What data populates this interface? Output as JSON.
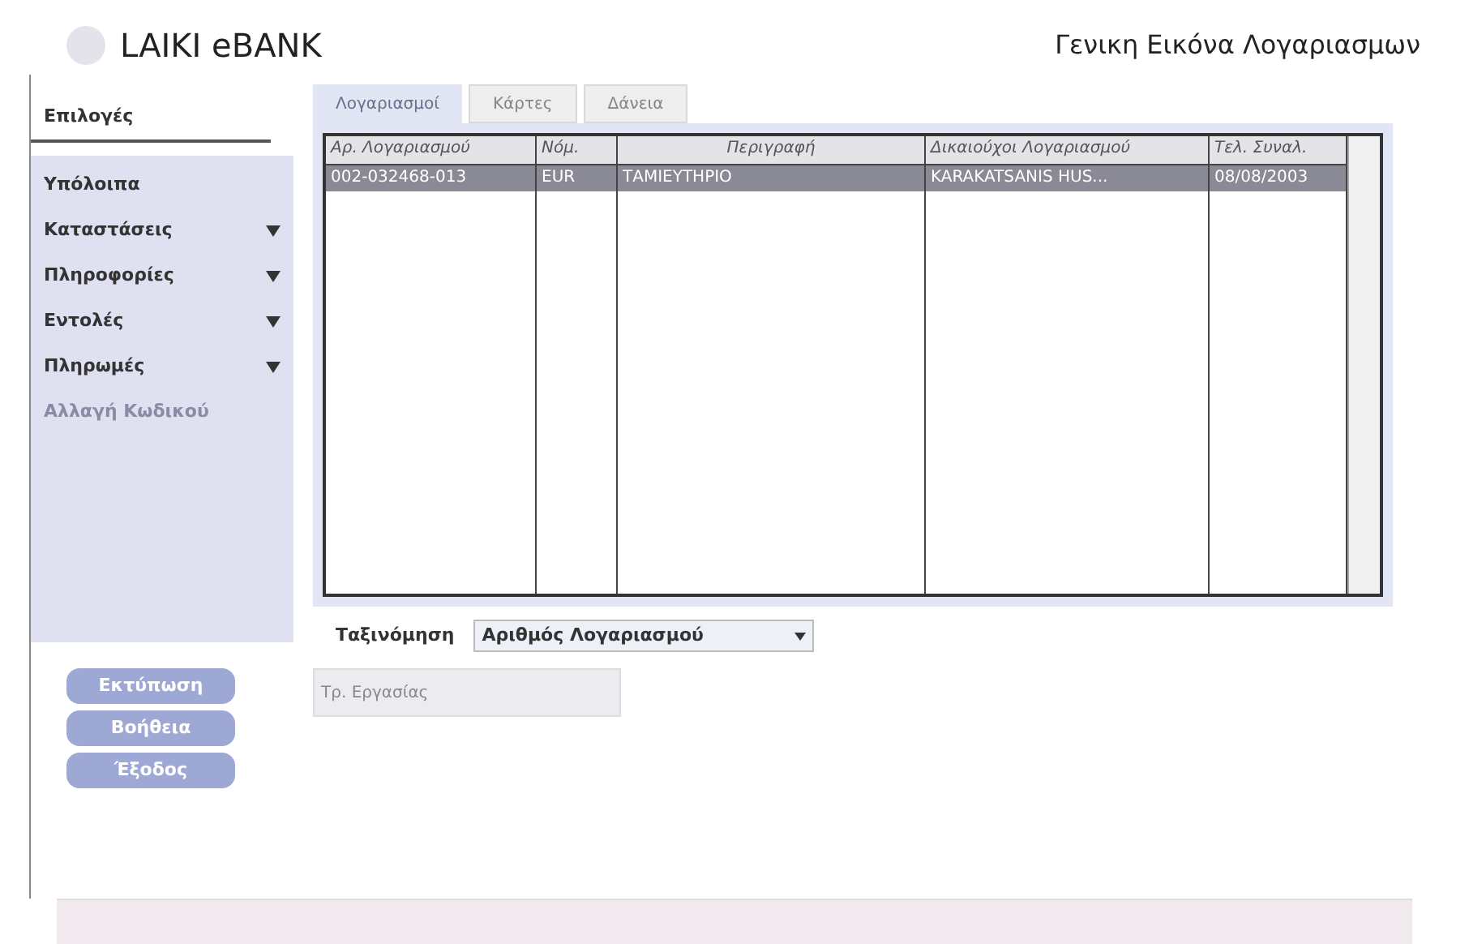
{
  "header": {
    "logo_text": "LAIKI eBANK",
    "title": "Γενικη Εικόνα Λογαριασμων"
  },
  "sidebar": {
    "heading": "Επιλογές",
    "items": [
      {
        "label": "Υπόλοιπα",
        "expandable": false,
        "disabled": false
      },
      {
        "label": "Καταστάσεις",
        "expandable": true,
        "disabled": false
      },
      {
        "label": "Πληροφορίες",
        "expandable": true,
        "disabled": false
      },
      {
        "label": "Εντολές",
        "expandable": true,
        "disabled": false
      },
      {
        "label": "Πληρωμές",
        "expandable": true,
        "disabled": false
      },
      {
        "label": "Αλλαγή Κωδικού",
        "expandable": false,
        "disabled": true
      }
    ],
    "buttons": [
      "Εκτύπωση",
      "Βοήθεια",
      "Έξοδος"
    ]
  },
  "tabs": [
    {
      "label": "Λογαριασμοί",
      "selected": true
    },
    {
      "label": "Κάρτες",
      "selected": false
    },
    {
      "label": "Δάνεια",
      "selected": false
    }
  ],
  "table": {
    "columns": [
      "Αρ. Λογαριασμού",
      "Νόμ.",
      "Περιγραφή",
      "Δικαιούχοι Λογαριασμού",
      "Τελ. Συναλ."
    ],
    "rows": [
      {
        "selected": true,
        "cells": [
          "002-032468-013",
          "EUR",
          "ΤΑΜΙΕΥΤΗΡΙΟ",
          "KARAKATSANIS HUS...",
          "08/08/2003"
        ]
      }
    ]
  },
  "sort": {
    "label": "Ταξινόμηση",
    "value": "Αριθμός Λογαριασμού"
  },
  "work_field": {
    "label": "Τρ. Εργασίας"
  }
}
